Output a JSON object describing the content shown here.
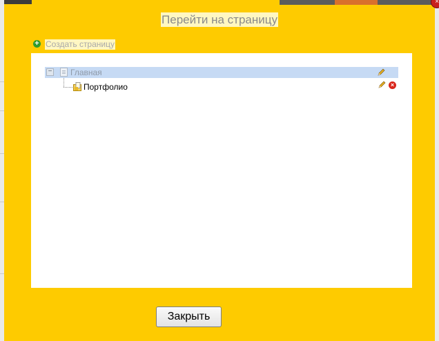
{
  "dialog": {
    "title": "Перейти на страницу",
    "create_link": "Создать страницу",
    "close_label": "Закрыть"
  },
  "tree": {
    "root": {
      "label": "Главная",
      "expanded": true,
      "selected": true,
      "icon": "page-icon"
    },
    "children": [
      {
        "label": "Портфолио",
        "icon": "folder-page-icon"
      }
    ]
  },
  "icons": {
    "create": "plus-circle-icon",
    "edit": "pencil-icon",
    "delete": "delete-circle-icon",
    "collapse": "minus-box-icon",
    "close_window": "close-x-icon"
  },
  "colors": {
    "dialog_bg": "#fecb00",
    "selection": "#c6daf4",
    "delete": "#d9261c",
    "create": "#2e9b2e"
  }
}
